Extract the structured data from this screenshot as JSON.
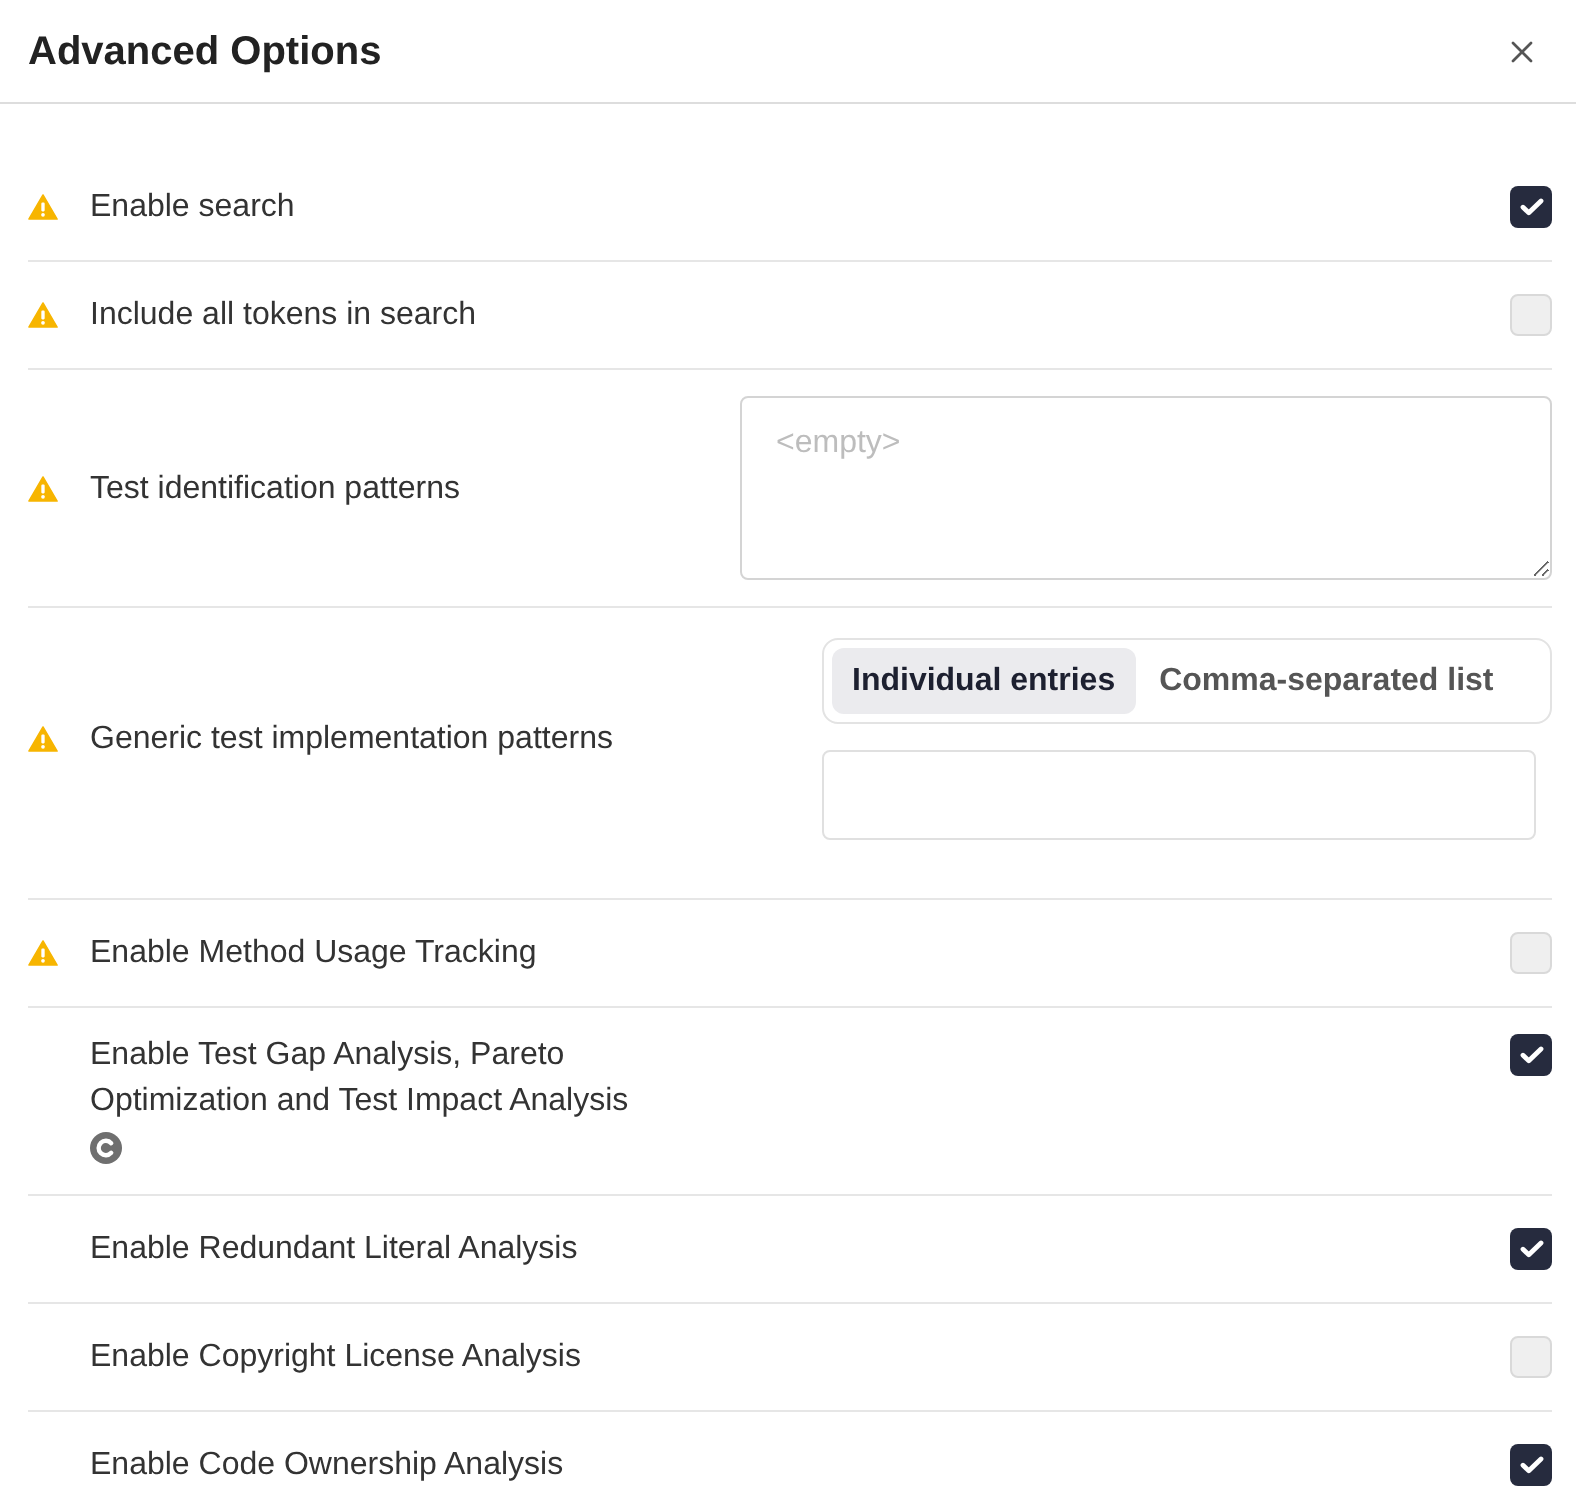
{
  "dialog": {
    "title": "Advanced Options"
  },
  "options": [
    {
      "kind": "checkbox",
      "label": "Enable search",
      "warning": true,
      "badge": false,
      "checked": true
    },
    {
      "kind": "checkbox",
      "label": "Include all tokens in search",
      "warning": true,
      "badge": false,
      "checked": false
    },
    {
      "kind": "textarea",
      "label": "Test identification patterns",
      "warning": true,
      "badge": false,
      "placeholder": "<empty>"
    },
    {
      "kind": "entries",
      "label": "Generic test implementation patterns",
      "warning": true,
      "badge": false,
      "modes": [
        {
          "label": "Individual entries",
          "selected": true
        },
        {
          "label": "Comma-separated list",
          "selected": false
        }
      ]
    },
    {
      "kind": "checkbox",
      "label": "Enable Method Usage Tracking",
      "warning": true,
      "badge": false,
      "checked": false
    },
    {
      "kind": "checkbox",
      "label": "Enable Test Gap Analysis, Pareto Optimization and Test Impact Analysis",
      "warning": false,
      "badge": true,
      "checked": true
    },
    {
      "kind": "checkbox",
      "label": "Enable Redundant Literal Analysis",
      "warning": false,
      "badge": false,
      "checked": true
    },
    {
      "kind": "checkbox",
      "label": "Enable Copyright License Analysis",
      "warning": false,
      "badge": false,
      "checked": false
    },
    {
      "kind": "checkbox",
      "label": "Enable Code Ownership Analysis",
      "warning": false,
      "badge": false,
      "checked": true
    }
  ]
}
